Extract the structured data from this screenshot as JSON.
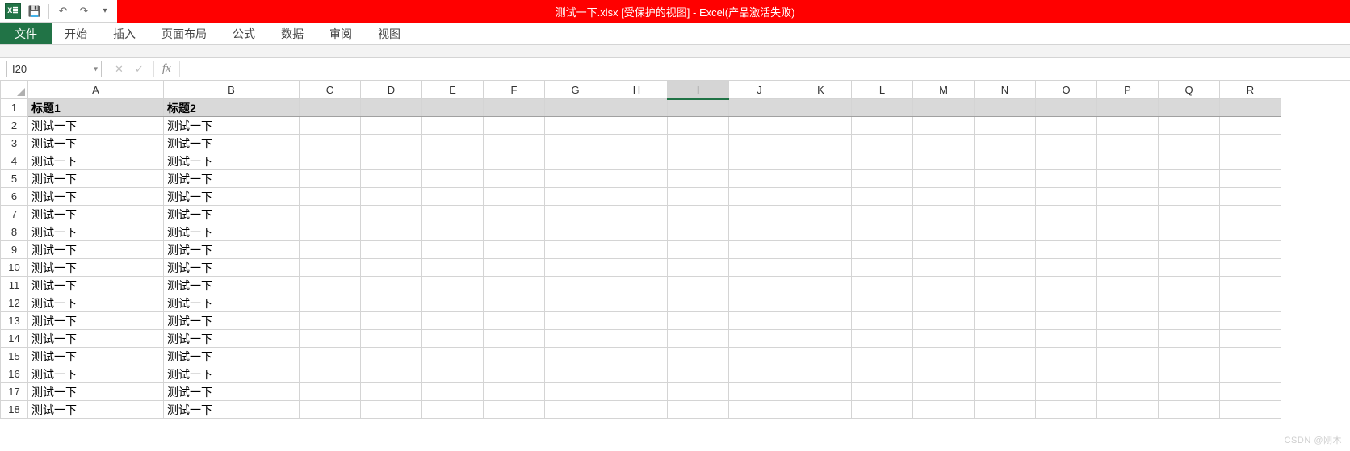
{
  "title_bar": {
    "text": "测试一下.xlsx  [受保护的视图]  -  Excel(产品激活失败)",
    "logo_text": "X≣"
  },
  "qat": {
    "save_icon": "💾",
    "undo_icon": "↶",
    "redo_icon": "↷",
    "dropdown_icon": "▾"
  },
  "ribbon": {
    "file": "文件",
    "tabs": [
      "开始",
      "插入",
      "页面布局",
      "公式",
      "数据",
      "审阅",
      "视图"
    ]
  },
  "name_box": {
    "value": "I20",
    "dropdown": "▾"
  },
  "formula_bar": {
    "cancel": "✕",
    "enter": "✓",
    "fx": "fx",
    "value": ""
  },
  "sheet": {
    "active_column": "I",
    "column_headers": [
      "A",
      "B",
      "C",
      "D",
      "E",
      "F",
      "G",
      "H",
      "I",
      "J",
      "K",
      "L",
      "M",
      "N",
      "O",
      "P",
      "Q",
      "R"
    ],
    "col_widths": {
      "default": 76,
      "A": 168,
      "B": 168
    },
    "header_row": [
      "标题1",
      "标题2"
    ],
    "rows": [
      [
        "测试一下",
        "测试一下"
      ],
      [
        "测试一下",
        "测试一下"
      ],
      [
        "测试一下",
        "测试一下"
      ],
      [
        "测试一下",
        "测试一下"
      ],
      [
        "测试一下",
        "测试一下"
      ],
      [
        "测试一下",
        "测试一下"
      ],
      [
        "测试一下",
        "测试一下"
      ],
      [
        "测试一下",
        "测试一下"
      ],
      [
        "测试一下",
        "测试一下"
      ],
      [
        "测试一下",
        "测试一下"
      ],
      [
        "测试一下",
        "测试一下"
      ],
      [
        "测试一下",
        "测试一下"
      ],
      [
        "测试一下",
        "测试一下"
      ],
      [
        "测试一下",
        "测试一下"
      ],
      [
        "测试一下",
        "测试一下"
      ],
      [
        "测试一下",
        "测试一下"
      ],
      [
        "测试一下",
        "测试一下"
      ]
    ],
    "row_count_visible": 18
  },
  "watermark": "CSDN @刚木"
}
